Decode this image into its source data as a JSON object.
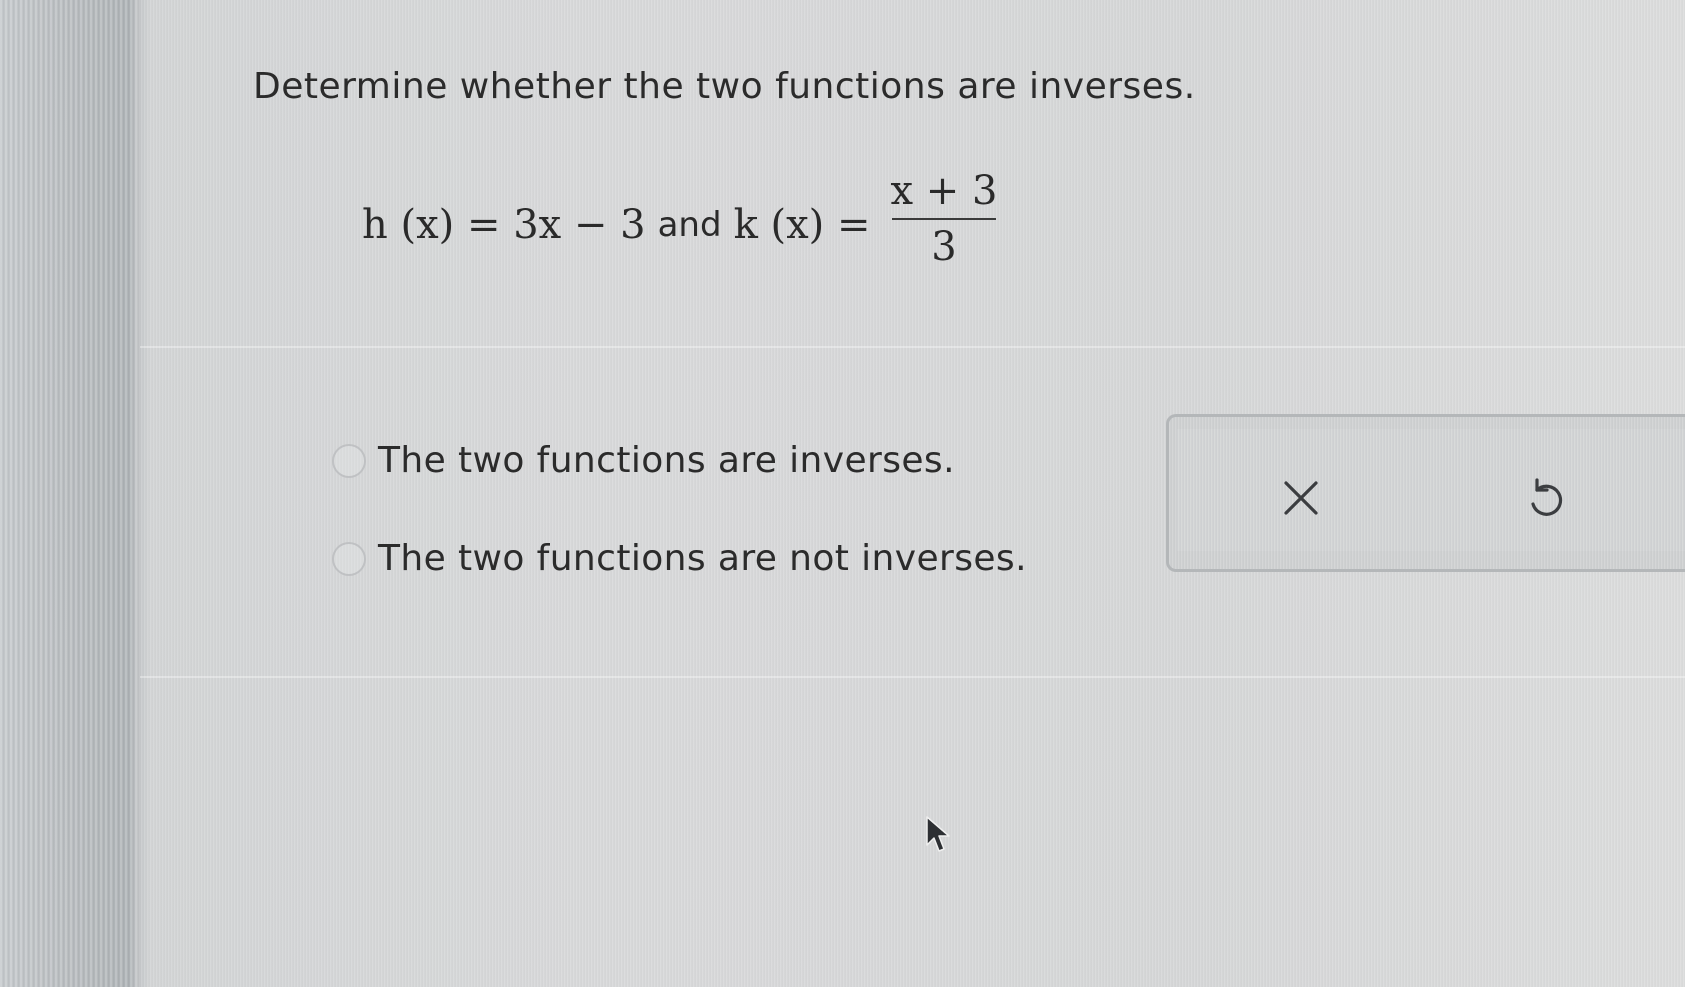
{
  "question": {
    "prompt": "Determine whether the two functions are inverses."
  },
  "equation": {
    "h_lhs": "h (x) = 3x − 3",
    "connector": "and",
    "k_lhs": "k (x) =",
    "k_numerator": "x + 3",
    "k_denominator": "3"
  },
  "options": [
    {
      "label": "The two functions are inverses.",
      "selected": false
    },
    {
      "label": "The two functions are not inverses.",
      "selected": false
    }
  ],
  "actions": {
    "clear_icon": "close-icon",
    "undo_icon": "undo-icon"
  }
}
